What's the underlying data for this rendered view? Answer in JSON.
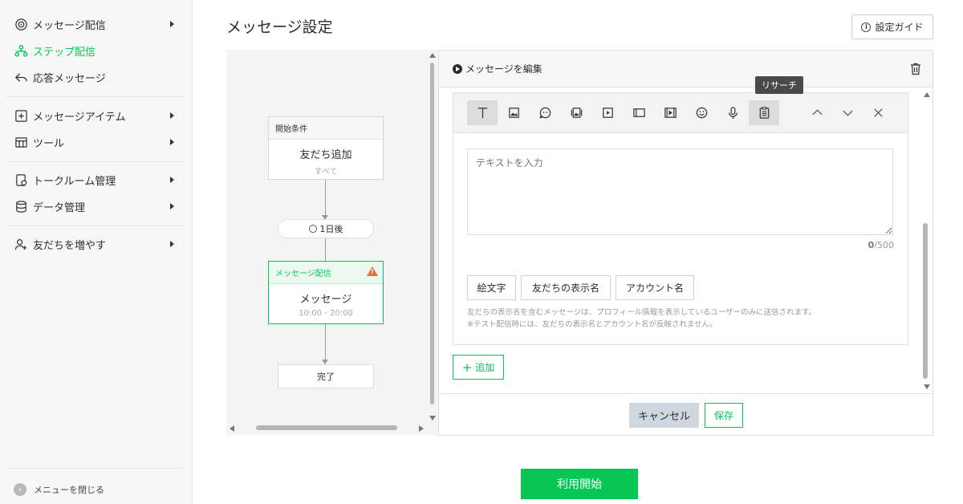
{
  "sidebar": {
    "items": [
      {
        "label": "メッセージ配信",
        "icon": "broadcast-icon",
        "has_arrow": true
      },
      {
        "label": "ステップ配信",
        "icon": "step-icon",
        "active": true
      },
      {
        "label": "応答メッセージ",
        "icon": "reply-icon"
      },
      {
        "label": "メッセージアイテム",
        "icon": "add-box-icon",
        "has_arrow": true
      },
      {
        "label": "ツール",
        "icon": "tools-icon",
        "has_arrow": true
      },
      {
        "label": "トークルーム管理",
        "icon": "chat-manage-icon",
        "has_arrow": true
      },
      {
        "label": "データ管理",
        "icon": "database-icon",
        "has_arrow": true
      },
      {
        "label": "友だちを増やす",
        "icon": "add-friend-icon",
        "has_arrow": true
      }
    ],
    "close_menu": "メニューを閉じる"
  },
  "header": {
    "title": "メッセージ設定",
    "guide_button": "設定ガイド"
  },
  "flow": {
    "start_node": {
      "header": "開始条件",
      "title": "友だち追加",
      "sub": "すべて"
    },
    "delay": "1日後",
    "message_node": {
      "header": "メッセージ配信",
      "title": "メッセージ",
      "sub": "10:00 - 20:00"
    },
    "end_node": "完了"
  },
  "editor": {
    "title": "メッセージを編集",
    "tooltip": "リサーチ",
    "toolbar_icons": [
      "text-icon",
      "image-icon",
      "stamp-icon",
      "card-icon",
      "video-icon",
      "rich-message-icon",
      "rich-video-icon",
      "emoji-icon",
      "voice-icon",
      "research-icon"
    ],
    "text_placeholder": "テキストを入力",
    "counter_value": "0",
    "counter_max": "/500",
    "insert_buttons": [
      "絵文字",
      "友だちの表示名",
      "アカウント名"
    ],
    "note_line1": "友だちの表示名を含むメッセージは、プロフィール情報を表示しているユーザーのみに送信されます。",
    "note_line2": "※テスト配信時には、友だちの表示名とアカウント名が反映されません。",
    "add_button": "追加",
    "cancel_button": "キャンセル",
    "save_button": "保存"
  },
  "start_button": "利用開始",
  "colors": {
    "accent": "#06c755",
    "warning": "#e8713a"
  }
}
